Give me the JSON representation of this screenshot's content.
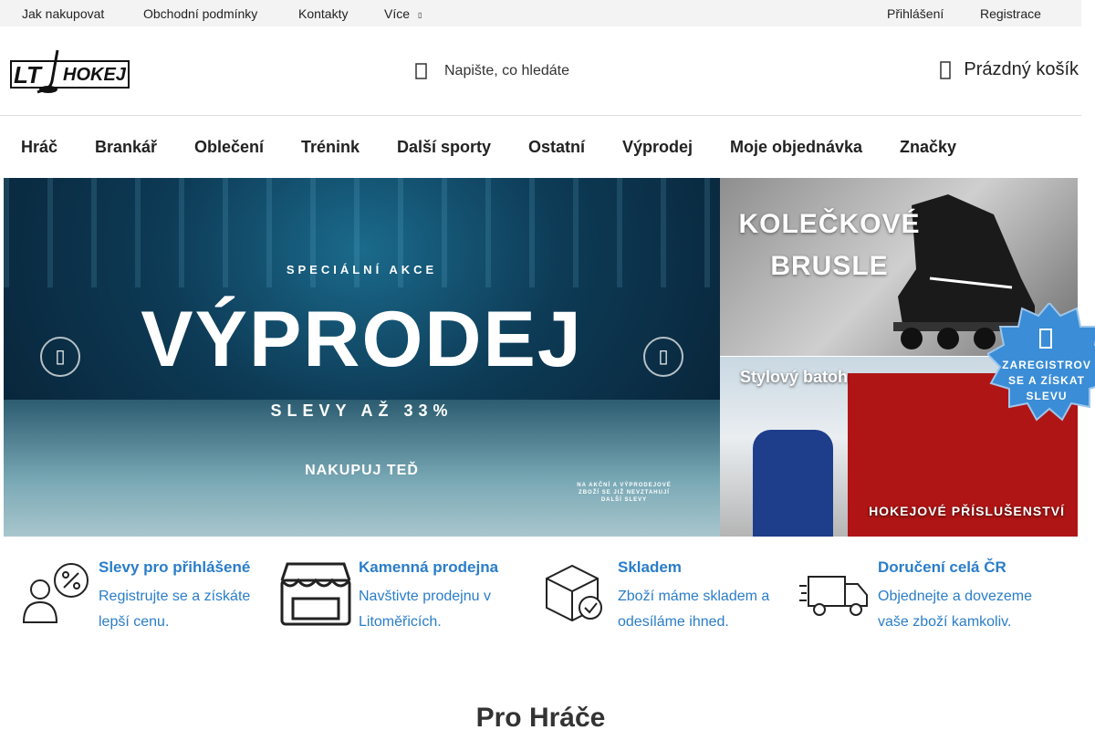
{
  "topbar": {
    "links": [
      "Jak nakupovat",
      "Obchodní podmínky",
      "Kontakty",
      "Více"
    ],
    "more_arrow": "▯",
    "login": "Přihlášení",
    "register": "Registrace"
  },
  "header": {
    "logo_text": "LT HOKEJ",
    "search_placeholder": "Napište, co hledáte",
    "cart_label": "Prázdný košík"
  },
  "mainnav": {
    "items": [
      "Hráč",
      "Brankář",
      "Oblečení",
      "Trénink",
      "Další sporty",
      "Ostatní",
      "Výprodej",
      "Moje objednávka",
      "Značky"
    ]
  },
  "banner": {
    "kicker": "SPECIÁLNÍ AKCE",
    "title": "VÝPRODEJ",
    "subtitle": "SLEVY AŽ 33%",
    "cta": "NAKUPUJ TEĎ",
    "note": "NA AKČNÍ A VÝPRODEJOVÉ ZBOŽÍ SE JIŽ NEVZTAHUJÍ DALŠÍ SLEVY",
    "prev_arrow": "▯",
    "next_arrow": "▯"
  },
  "side_banners": {
    "skates_line1": "KOLEČKOVÉ",
    "skates_line2": "BRUSLE",
    "bag_title": "Stylový batoh",
    "bag_caption": "HOKEJOVÉ PŘÍSLUŠENSTVÍ"
  },
  "badge": {
    "line1": "ZAREGISTROV",
    "line2": "SE A ZÍSKAT",
    "line3": "SLEVU"
  },
  "benefits": [
    {
      "title": "Slevy pro přihlášené",
      "desc": "Registrujte se a získáte lepší cenu.",
      "icon": "user-discount-icon"
    },
    {
      "title": "Kamenná prodejna",
      "desc": "Navštivte prodejnu v Litoměřicích.",
      "icon": "store-icon"
    },
    {
      "title": "Skladem",
      "desc": "Zboží máme skladem a odesíláme ihned.",
      "icon": "box-check-icon"
    },
    {
      "title": "Doručení celá ČR",
      "desc": "Objednejte a dovezeme vaše zboží kamkoliv.",
      "icon": "truck-icon"
    }
  ],
  "section_title": "Pro Hráče",
  "colors": {
    "accent_blue": "#2a7dc9",
    "badge_blue": "#3a8dd6",
    "topbar_bg": "#f3f3f3"
  }
}
